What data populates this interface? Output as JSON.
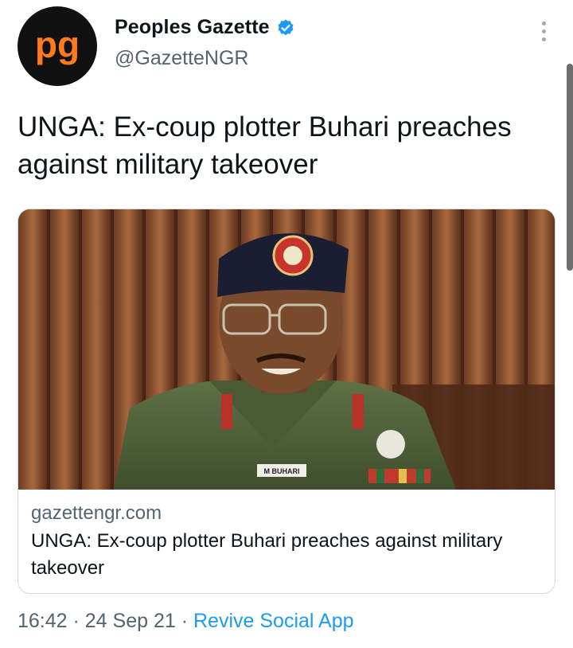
{
  "author": {
    "avatar_text": "pg",
    "display_name": "Peoples Gazette",
    "handle": "@GazetteNGR",
    "verified": true
  },
  "tweet": {
    "text": "UNGA: Ex-coup plotter Buhari preaches against military takeover"
  },
  "card": {
    "image_icon": "photo-soldier-portrait",
    "nameplate": "M BUHARI",
    "domain": "gazettengr.com",
    "title": "UNGA: Ex-coup plotter Buhari preaches against military takeover"
  },
  "meta": {
    "time": "16:42",
    "separator": " · ",
    "date": "24 Sep 21",
    "app": "Revive Social App"
  },
  "icons": {
    "more": "more-vertical-icon",
    "verified": "verified-badge-icon"
  },
  "colors": {
    "link": "#1d9bf0",
    "secondary_text": "#536471",
    "avatar_orange": "#ff7a1a",
    "verified_blue": "#1d9bf0"
  }
}
